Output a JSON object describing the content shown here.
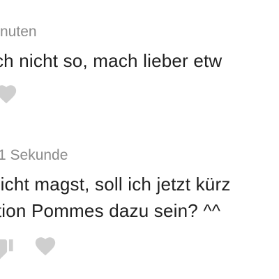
{
  "comments": [
    {
      "timestamp": "nuten",
      "text_lines": [
        "ich nicht so, mach lieber etw"
      ]
    },
    {
      "timestamp": "1 Sekunde",
      "text_lines": [
        "nicht magst, soll ich jetzt kürz",
        "rtion Pommes dazu sein? ^^"
      ]
    }
  ],
  "icons": {
    "like": "heart-icon",
    "dislike": "thumbs-down-icon"
  },
  "colors": {
    "text": "#1f1f1f",
    "meta": "#8a8a8a",
    "icon": "#cfcfcf",
    "background": "#ffffff"
  }
}
